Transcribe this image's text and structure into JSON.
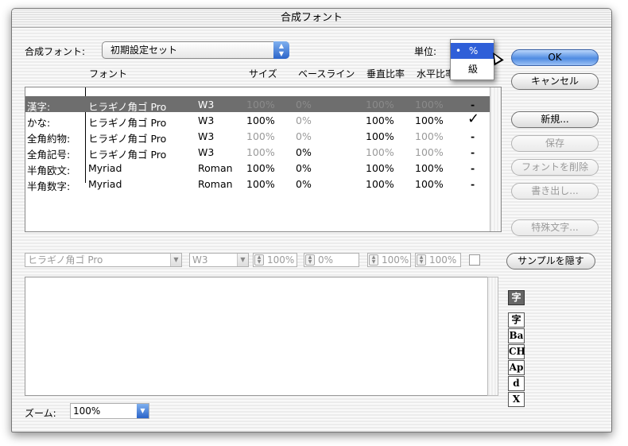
{
  "window": {
    "title": "合成フォント"
  },
  "composite": {
    "label": "合成フォント:",
    "value": "初期設定セット"
  },
  "unit": {
    "label": "単位:",
    "options": [
      "%",
      "級"
    ],
    "selected": "%"
  },
  "headers": {
    "font": "フォント",
    "size": "サイズ",
    "baseline": "ベースライン",
    "vscale": "垂直比率",
    "hscale": "水平比率"
  },
  "rows": [
    {
      "name": "漢字:",
      "font": "ヒラギノ角ゴ Pro",
      "style": "W3",
      "size": "100%",
      "baseline": "0%",
      "vscale": "100%",
      "hscale": "100%",
      "mark": "-"
    },
    {
      "name": "かな:",
      "font": "ヒラギノ角ゴ Pro",
      "style": "W3",
      "size": "100%",
      "baseline": "0%",
      "vscale": "100%",
      "hscale": "100%",
      "mark": "✓"
    },
    {
      "name": "全角約物:",
      "font": "ヒラギノ角ゴ Pro",
      "style": "W3",
      "size": "100%",
      "baseline": "0%",
      "vscale": "100%",
      "hscale": "100%",
      "mark": "-"
    },
    {
      "name": "全角記号:",
      "font": "ヒラギノ角ゴ Pro",
      "style": "W3",
      "size": "100%",
      "baseline": "0%",
      "vscale": "100%",
      "hscale": "100%",
      "mark": "-"
    },
    {
      "name": "半角欧文:",
      "font": "Myriad",
      "style": "Roman",
      "size": "100%",
      "baseline": "0%",
      "vscale": "100%",
      "hscale": "100%",
      "mark": "-"
    },
    {
      "name": "半角数字:",
      "font": "Myriad",
      "style": "Roman",
      "size": "100%",
      "baseline": "0%",
      "vscale": "100%",
      "hscale": "100%",
      "mark": "-"
    }
  ],
  "editor": {
    "font": "ヒラギノ角ゴ Pro",
    "style": "W3",
    "size": "100%",
    "baseline": "0%",
    "vscale": "100%",
    "hscale": "100%"
  },
  "buttons": {
    "ok": "OK",
    "cancel": "キャンセル",
    "new": "新規...",
    "save": "保存",
    "delete": "フォントを削除",
    "export": "書き出し...",
    "special": "特殊文字...",
    "hide_sample": "サンプルを隠す"
  },
  "zoom": {
    "label": "ズーム:",
    "value": "100%"
  },
  "glyph_buttons": [
    "字",
    "字",
    "Ba",
    "CH",
    "Ap",
    "d",
    "X"
  ]
}
